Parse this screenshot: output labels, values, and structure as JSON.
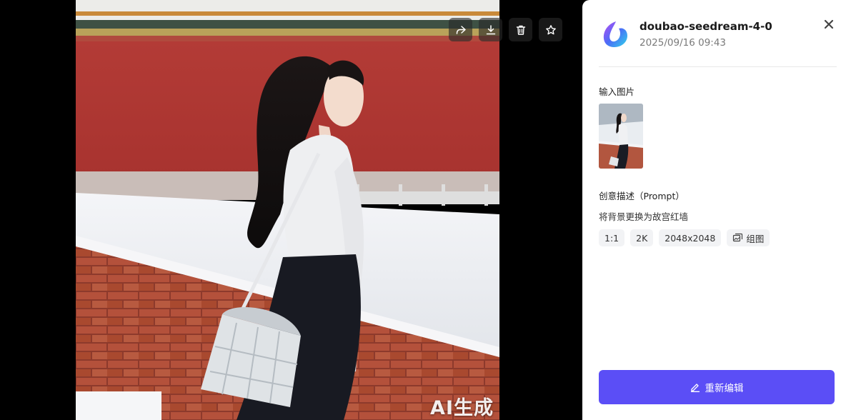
{
  "viewer": {
    "watermark": "AI生成",
    "toolbar": [
      {
        "icon": "share-icon"
      },
      {
        "icon": "download-icon"
      },
      {
        "icon": "trash-icon"
      },
      {
        "icon": "star-icon"
      }
    ]
  },
  "panel": {
    "model_name": "doubao-seedream-4-0",
    "timestamp": "2025/09/16 09:43",
    "close_icon": "close-icon",
    "input_label": "输入图片",
    "prompt_label": "创意描述（Prompt）",
    "prompt_text": "将背景更换为故宫红墙",
    "tags": {
      "ratio": "1:1",
      "resolution": "2K",
      "size": "2048x2048",
      "group": "组图"
    },
    "reedit_label": "重新编辑",
    "accent": "#5b4ef6"
  }
}
